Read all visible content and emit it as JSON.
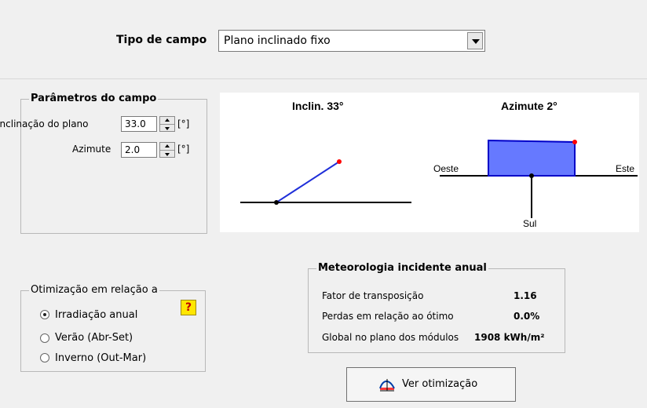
{
  "header": {
    "field_type_label": "Tipo de campo",
    "field_type_value": "Plano inclinado fixo"
  },
  "parameters": {
    "title": "Parâmetros do campo",
    "tilt_label": "Inclinação do plano",
    "tilt_value": "33.0",
    "tilt_unit": "[°]",
    "azimuth_label": "Azimute",
    "azimuth_value": "2.0",
    "azimuth_unit": "[°]"
  },
  "diagram": {
    "tilt_title": "Inclin. 33°",
    "azimuth_title": "Azimute 2°",
    "west_label": "Oeste",
    "east_label": "Este",
    "south_label": "Sul",
    "colors": {
      "line": "#0000ff",
      "fill": "#6a7cff",
      "point": "#ff0000"
    }
  },
  "optimization": {
    "title": "Otimização em relação a",
    "options": [
      {
        "label": "Irradiação anual",
        "selected": true
      },
      {
        "label": "Verão (Abr-Set)",
        "selected": false
      },
      {
        "label": "Inverno (Out-Mar)",
        "selected": false
      }
    ],
    "help_label": "?"
  },
  "meteo": {
    "title": "Meteorologia incidente anual",
    "rows": [
      {
        "label": "Fator de transposição",
        "value": "1.16"
      },
      {
        "label": "Perdas em relação ao ótimo",
        "value": "0.0%"
      },
      {
        "label": "Global no plano dos módulos",
        "value": "1908 kWh/m²"
      }
    ]
  },
  "actions": {
    "view_optimization": "Ver otimização"
  }
}
